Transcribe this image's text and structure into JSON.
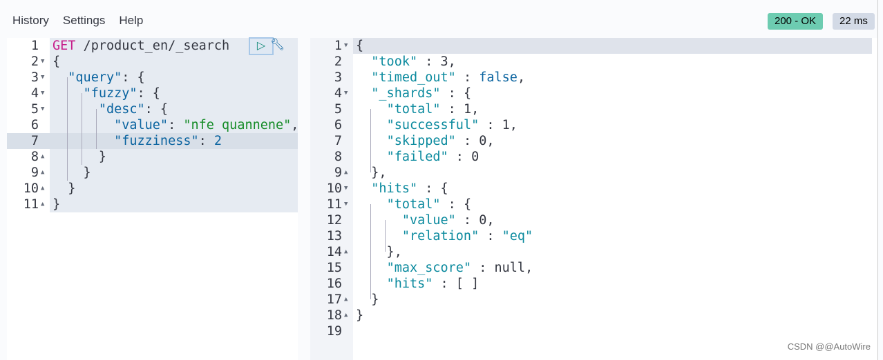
{
  "menu": [
    "History",
    "Settings",
    "Help"
  ],
  "status": {
    "code": "200 - OK",
    "time": "22 ms",
    "ok_color": "#6dccb1"
  },
  "request": {
    "lines": [
      {
        "n": "1",
        "fold": "",
        "tokens": [
          [
            "m",
            "GET"
          ],
          [
            "u",
            " /product_en/_search"
          ]
        ]
      },
      {
        "n": "2",
        "fold": "down",
        "tokens": [
          [
            "p",
            "{"
          ]
        ]
      },
      {
        "n": "3",
        "fold": "down",
        "tokens": [
          [
            "p",
            "  "
          ],
          [
            "k",
            "\"query\""
          ],
          [
            "p",
            ": {"
          ]
        ]
      },
      {
        "n": "4",
        "fold": "down",
        "tokens": [
          [
            "p",
            "    "
          ],
          [
            "k",
            "\"fuzzy\""
          ],
          [
            "p",
            ": {"
          ]
        ]
      },
      {
        "n": "5",
        "fold": "down",
        "tokens": [
          [
            "p",
            "      "
          ],
          [
            "k",
            "\"desc\""
          ],
          [
            "p",
            ": {"
          ]
        ]
      },
      {
        "n": "6",
        "fold": "",
        "tokens": [
          [
            "p",
            "        "
          ],
          [
            "k",
            "\"value\""
          ],
          [
            "p",
            ": "
          ],
          [
            "s",
            "\"nfe quannene\""
          ],
          [
            "p",
            ","
          ]
        ]
      },
      {
        "n": "7",
        "fold": "",
        "tokens": [
          [
            "p",
            "        "
          ],
          [
            "k",
            "\"fuzziness\""
          ],
          [
            "p",
            ": "
          ],
          [
            "n",
            "2"
          ]
        ]
      },
      {
        "n": "8",
        "fold": "up",
        "tokens": [
          [
            "p",
            "      }"
          ]
        ]
      },
      {
        "n": "9",
        "fold": "up",
        "tokens": [
          [
            "p",
            "    }"
          ]
        ]
      },
      {
        "n": "10",
        "fold": "up",
        "tokens": [
          [
            "p",
            "  }"
          ]
        ]
      },
      {
        "n": "11",
        "fold": "up",
        "tokens": [
          [
            "p",
            "}"
          ]
        ]
      }
    ]
  },
  "response": {
    "lines": [
      {
        "n": "1",
        "fold": "down",
        "tokens": [
          [
            "p",
            "{"
          ]
        ]
      },
      {
        "n": "2",
        "fold": "",
        "tokens": [
          [
            "p",
            "  "
          ],
          [
            "rk",
            "\"took\""
          ],
          [
            "p",
            " : "
          ],
          [
            "rn",
            "3"
          ],
          [
            "p",
            ","
          ]
        ]
      },
      {
        "n": "3",
        "fold": "",
        "tokens": [
          [
            "p",
            "  "
          ],
          [
            "rk",
            "\"timed_out\""
          ],
          [
            "p",
            " : "
          ],
          [
            "n",
            "false"
          ],
          [
            "p",
            ","
          ]
        ]
      },
      {
        "n": "4",
        "fold": "down",
        "tokens": [
          [
            "p",
            "  "
          ],
          [
            "rk",
            "\"_shards\""
          ],
          [
            "p",
            " : {"
          ]
        ]
      },
      {
        "n": "5",
        "fold": "",
        "tokens": [
          [
            "p",
            "    "
          ],
          [
            "rk",
            "\"total\""
          ],
          [
            "p",
            " : "
          ],
          [
            "rn",
            "1"
          ],
          [
            "p",
            ","
          ]
        ]
      },
      {
        "n": "6",
        "fold": "",
        "tokens": [
          [
            "p",
            "    "
          ],
          [
            "rk",
            "\"successful\""
          ],
          [
            "p",
            " : "
          ],
          [
            "rn",
            "1"
          ],
          [
            "p",
            ","
          ]
        ]
      },
      {
        "n": "7",
        "fold": "",
        "tokens": [
          [
            "p",
            "    "
          ],
          [
            "rk",
            "\"skipped\""
          ],
          [
            "p",
            " : "
          ],
          [
            "rn",
            "0"
          ],
          [
            "p",
            ","
          ]
        ]
      },
      {
        "n": "8",
        "fold": "",
        "tokens": [
          [
            "p",
            "    "
          ],
          [
            "rk",
            "\"failed\""
          ],
          [
            "p",
            " : "
          ],
          [
            "rn",
            "0"
          ]
        ]
      },
      {
        "n": "9",
        "fold": "up",
        "tokens": [
          [
            "p",
            "  },"
          ]
        ]
      },
      {
        "n": "10",
        "fold": "down",
        "tokens": [
          [
            "p",
            "  "
          ],
          [
            "rk",
            "\"hits\""
          ],
          [
            "p",
            " : {"
          ]
        ]
      },
      {
        "n": "11",
        "fold": "down",
        "tokens": [
          [
            "p",
            "    "
          ],
          [
            "rk",
            "\"total\""
          ],
          [
            "p",
            " : {"
          ]
        ]
      },
      {
        "n": "12",
        "fold": "",
        "tokens": [
          [
            "p",
            "      "
          ],
          [
            "rk",
            "\"value\""
          ],
          [
            "p",
            " : "
          ],
          [
            "rn",
            "0"
          ],
          [
            "p",
            ","
          ]
        ]
      },
      {
        "n": "13",
        "fold": "",
        "tokens": [
          [
            "p",
            "      "
          ],
          [
            "rk",
            "\"relation\""
          ],
          [
            "p",
            " : "
          ],
          [
            "rk",
            "\"eq\""
          ]
        ]
      },
      {
        "n": "14",
        "fold": "up",
        "tokens": [
          [
            "p",
            "    },"
          ]
        ]
      },
      {
        "n": "15",
        "fold": "",
        "tokens": [
          [
            "p",
            "    "
          ],
          [
            "rk",
            "\"max_score\""
          ],
          [
            "p",
            " : "
          ],
          [
            "rn",
            "null"
          ],
          [
            "p",
            ","
          ]
        ]
      },
      {
        "n": "16",
        "fold": "",
        "tokens": [
          [
            "p",
            "    "
          ],
          [
            "rk",
            "\"hits\""
          ],
          [
            "p",
            " : [ ]"
          ]
        ]
      },
      {
        "n": "17",
        "fold": "up",
        "tokens": [
          [
            "p",
            "  }"
          ]
        ]
      },
      {
        "n": "18",
        "fold": "up",
        "tokens": [
          [
            "p",
            "}"
          ]
        ]
      },
      {
        "n": "19",
        "fold": "",
        "tokens": []
      }
    ]
  },
  "watermark": "CSDN @@AutoWire"
}
